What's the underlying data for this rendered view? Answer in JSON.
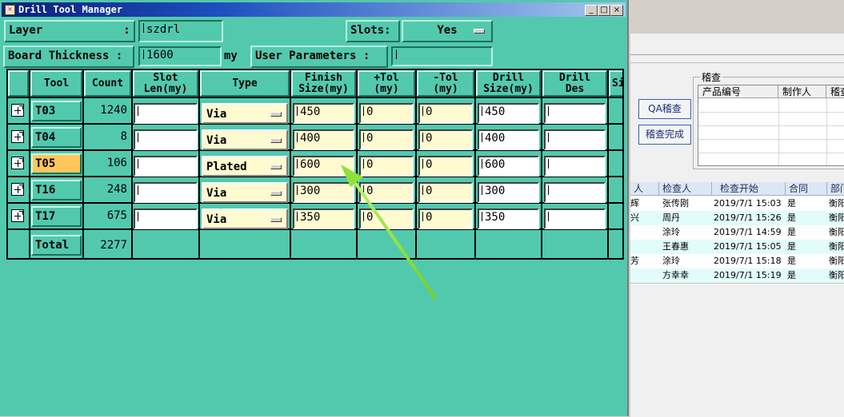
{
  "window": {
    "title": "Drill Tool Manager",
    "buttons": [
      "_",
      "□",
      "×"
    ]
  },
  "form": {
    "layer_label": "Layer            :",
    "layer_value": "szdrl",
    "slots_label": "Slots:",
    "slots_value": "Yes",
    "board_thickness_label": "Board Thickness :",
    "board_thickness_value": "1600",
    "board_thickness_unit": "my",
    "user_params_label": "User Parameters :",
    "user_params_value": ""
  },
  "table": {
    "headers": [
      "Tool",
      "Count",
      "Slot\nLen(my)",
      "Type",
      "Finish\nSize(my)",
      "+Tol\n(my)",
      "-Tol\n(my)",
      "Drill\nSize(my)",
      "Drill\nDes",
      "Si"
    ],
    "rows": [
      {
        "tool": "T03",
        "count": "1240",
        "slot_len": "",
        "type": "Via",
        "finish": "450",
        "ptol": "0",
        "ntol": "0",
        "drill": "450",
        "des": "",
        "highlight": false
      },
      {
        "tool": "T04",
        "count": "8",
        "slot_len": "",
        "type": "Via",
        "finish": "400",
        "ptol": "0",
        "ntol": "0",
        "drill": "400",
        "des": "",
        "highlight": false
      },
      {
        "tool": "T05",
        "count": "106",
        "slot_len": "",
        "type": "Plated",
        "finish": "600",
        "ptol": "0",
        "ntol": "0",
        "drill": "600",
        "des": "",
        "highlight": true
      },
      {
        "tool": "T16",
        "count": "248",
        "slot_len": "",
        "type": "Via",
        "finish": "300",
        "ptol": "0",
        "ntol": "0",
        "drill": "300",
        "des": "",
        "highlight": false
      },
      {
        "tool": "T17",
        "count": "675",
        "slot_len": "",
        "type": "Via",
        "finish": "350",
        "ptol": "0",
        "ntol": "0",
        "drill": "350",
        "des": "",
        "highlight": false
      }
    ],
    "total_label": "Total",
    "total_count": "2277"
  },
  "colors": {
    "background": "#52c9ad",
    "highlight_tool": "#ffc75a",
    "arrow": "#7fdc2c",
    "input_yellow": "#fffad0"
  },
  "right_app": {
    "group_title": "稽查",
    "qa_button": "QA稽查",
    "done_button": "稽查完成",
    "mini_headers": [
      "产品编号",
      "制作人",
      "稽查"
    ],
    "list_headers": [
      "人",
      "检查人",
      "检查开始",
      "合同",
      "部门"
    ],
    "list_rows": [
      {
        "a": "辉",
        "inspector": "张传刚",
        "start": "2019/7/1 15:03",
        "contract": "是",
        "dept": "衡阳"
      },
      {
        "a": "兴",
        "inspector": "周丹",
        "start": "2019/7/1 15:26",
        "contract": "是",
        "dept": "衡阳"
      },
      {
        "a": "",
        "inspector": "涂玲",
        "start": "2019/7/1 14:59",
        "contract": "是",
        "dept": "衡阳"
      },
      {
        "a": "",
        "inspector": "王春惠",
        "start": "2019/7/1 15:05",
        "contract": "是",
        "dept": "衡阳"
      },
      {
        "a": "芳",
        "inspector": "涂玲",
        "start": "2019/7/1 15:18",
        "contract": "是",
        "dept": "衡阳"
      },
      {
        "a": "",
        "inspector": "方幸幸",
        "start": "2019/7/1 15:19",
        "contract": "是",
        "dept": "衡阳"
      }
    ]
  }
}
